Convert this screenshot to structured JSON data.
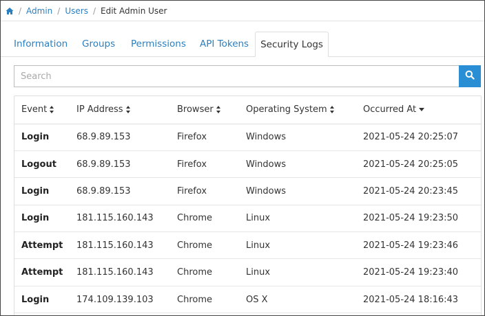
{
  "breadcrumb": {
    "home_icon": "home-icon",
    "items": [
      "Admin",
      "Users"
    ],
    "separator": "/",
    "current": "Edit Admin User"
  },
  "tabs": [
    {
      "label": "Information",
      "active": false
    },
    {
      "label": "Groups",
      "active": false
    },
    {
      "label": "Permissions",
      "active": false
    },
    {
      "label": "API Tokens",
      "active": false
    },
    {
      "label": "Security Logs",
      "active": true
    }
  ],
  "search": {
    "placeholder": "Search",
    "value": "",
    "button_icon": "search-icon",
    "button_color": "#2a8ed5"
  },
  "colors": {
    "link": "#2a7fc0"
  },
  "table": {
    "columns": [
      {
        "label": "Event",
        "sort": "both"
      },
      {
        "label": "IP Address",
        "sort": "both"
      },
      {
        "label": "Browser",
        "sort": "both"
      },
      {
        "label": "Operating System",
        "sort": "both"
      },
      {
        "label": "Occurred At",
        "sort": "desc"
      }
    ],
    "rows": [
      {
        "event": "Login",
        "ip": "68.9.89.153",
        "browser": "Firefox",
        "os": "Windows",
        "occurred": "2021-05-24 20:25:07"
      },
      {
        "event": "Logout",
        "ip": "68.9.89.153",
        "browser": "Firefox",
        "os": "Windows",
        "occurred": "2021-05-24 20:25:05"
      },
      {
        "event": "Login",
        "ip": "68.9.89.153",
        "browser": "Firefox",
        "os": "Windows",
        "occurred": "2021-05-24 20:23:45"
      },
      {
        "event": "Login",
        "ip": "181.115.160.143",
        "browser": "Chrome",
        "os": "Linux",
        "occurred": "2021-05-24 19:23:50"
      },
      {
        "event": "Attempt",
        "ip": "181.115.160.143",
        "browser": "Chrome",
        "os": "Linux",
        "occurred": "2021-05-24 19:23:46"
      },
      {
        "event": "Attempt",
        "ip": "181.115.160.143",
        "browser": "Chrome",
        "os": "Linux",
        "occurred": "2021-05-24 19:23:40"
      },
      {
        "event": "Login",
        "ip": "174.109.139.103",
        "browser": "Chrome",
        "os": "OS X",
        "occurred": "2021-05-24 18:16:43"
      }
    ]
  }
}
